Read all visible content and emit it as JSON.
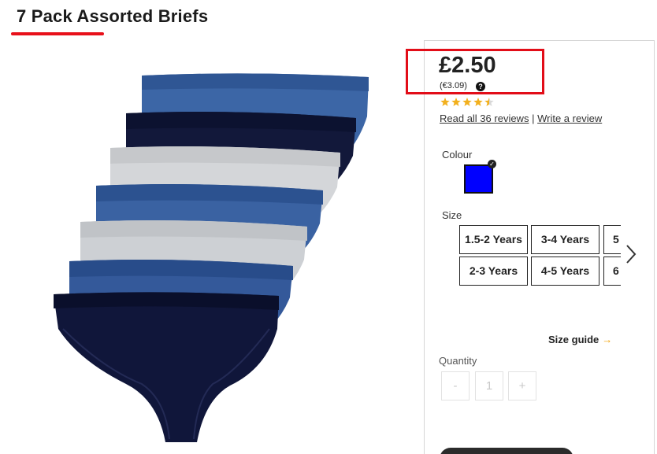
{
  "product": {
    "title": "7 Pack Assorted Briefs",
    "price": "£2.50",
    "alt_price": "(€3.09)",
    "rating": 4.5,
    "rating_max": 5,
    "reviews_link": "Read all 36 reviews",
    "review_separator": "|",
    "write_review_link": "Write a review"
  },
  "colour": {
    "label": "Colour",
    "selected_swatch": "#0000ff"
  },
  "size": {
    "label": "Size",
    "options": [
      "1.5-2 Years",
      "3-4 Years",
      "5",
      "2-3 Years",
      "4-5 Years",
      "6"
    ]
  },
  "size_guide": {
    "label": "Size guide",
    "arrow": "→"
  },
  "quantity": {
    "label": "Quantity",
    "minus": "-",
    "value": "1",
    "plus": "+"
  },
  "icons": {
    "help": "?",
    "check": "✓"
  },
  "colors": {
    "accent_red": "#e20d18",
    "star": "#f2b01e",
    "guide_arrow": "#f0a000"
  }
}
